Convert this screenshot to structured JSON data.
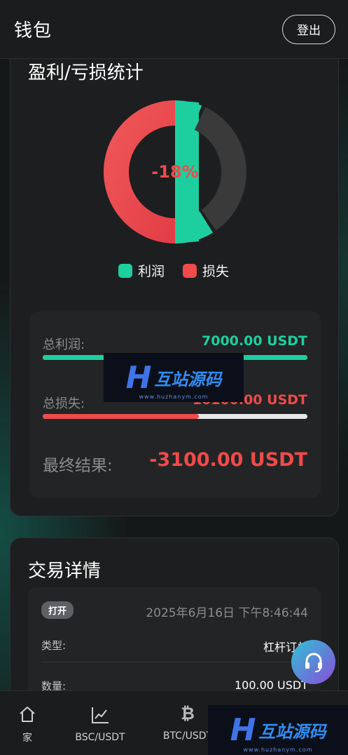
{
  "header": {
    "title": "钱包",
    "logout_label": "登出"
  },
  "pl_card": {
    "title": "盈利/亏损统计",
    "center_label": "-18%",
    "profit_ratio": 0.4118,
    "legend": {
      "profit": "利润",
      "loss": "损失"
    },
    "colors": {
      "profit": "#1dcf9f",
      "loss": "#f04a4a",
      "rest": "#3a3a3b"
    },
    "total_profit_label": "总利润:",
    "total_profit_value": "7000.00 USDT",
    "total_profit_fill": 1.0,
    "total_loss_label": "总损失:",
    "total_loss_value": "10100.00 USDT",
    "total_loss_fill": 0.59,
    "final_label": "最终结果:",
    "final_value": "-3100.00 USDT"
  },
  "trade_card": {
    "title": "交易详情",
    "order": {
      "status": "打开",
      "time": "2025年6月16日 下午8:46:44",
      "type_label": "类型:",
      "type_value": "杠杆订单",
      "quantity_label": "数量:",
      "quantity_value": "100.00 USDT"
    }
  },
  "watermark": {
    "brand": "互站源码",
    "url": "www.huzhanym.com",
    "letter": "H"
  },
  "bottom_nav": {
    "items": [
      {
        "label": "家",
        "icon": "home-icon"
      },
      {
        "label": "BSC/USDT",
        "icon": "line-chart-icon"
      },
      {
        "label": "BTC/USDT",
        "icon": "bitcoin-icon"
      },
      {
        "label": "",
        "icon": ""
      }
    ]
  },
  "support": {
    "icon": "headset-icon"
  }
}
